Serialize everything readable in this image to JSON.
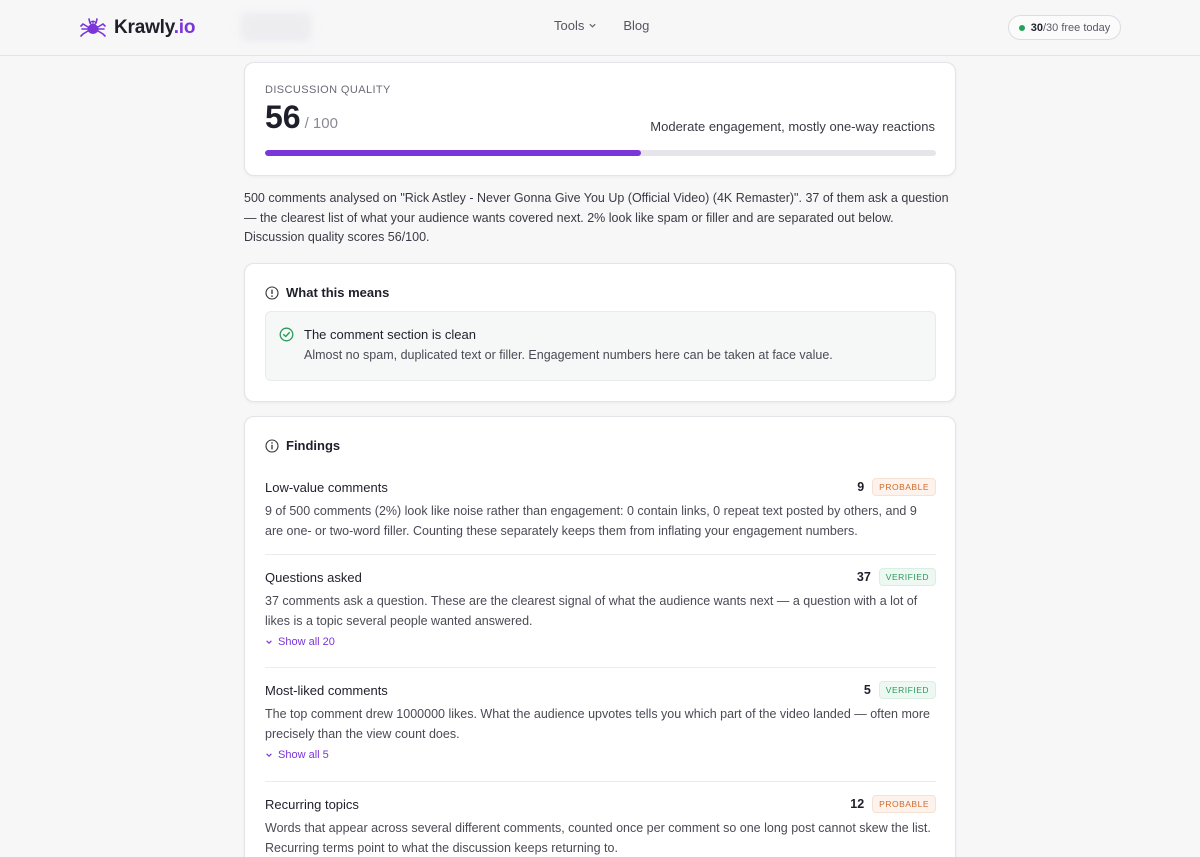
{
  "nav": {
    "brand_main": "Krawly",
    "brand_tld": ".io",
    "links": [
      {
        "label": "Tools",
        "has_dropdown": true
      },
      {
        "label": "Blog",
        "has_dropdown": false
      }
    ],
    "quota": {
      "used": "30",
      "rest": "/30 free today",
      "status_color": "#22a35a"
    }
  },
  "score": {
    "label": "DISCUSSION QUALITY",
    "value": "56",
    "max": "/ 100",
    "fraction": 0.56,
    "description": "Moderate engagement, mostly one-way reactions",
    "accent": "#7b36d9"
  },
  "summary": "500 comments analysed on \"Rick Astley - Never Gonna Give You Up (Official Video) (4K Remaster)\". 37 of them ask a question — the clearest list of what your audience wants covered next. 2% look like spam or filler and are separated out below. Discussion quality scores 56/100.",
  "meaning": {
    "title": "What this means",
    "icon": "info-circle-icon",
    "status_title": "The comment section is clean",
    "status_icon": "check-circle-icon",
    "status_text": "Almost no spam, duplicated text or filler. Engagement numbers here can be taken at face value."
  },
  "findings": {
    "title": "Findings",
    "icon": "info-circle-icon",
    "items": [
      {
        "title": "Low-value comments",
        "count": "9",
        "badge": "PROBABLE",
        "body": "9 of 500 comments (2%) look like noise rather than engagement: 0 contain links, 0 repeat text posted by others, and 9 are one- or two-word filler. Counting these separately keeps them from inflating your engagement numbers."
      },
      {
        "title": "Questions asked",
        "count": "37",
        "badge": "VERIFIED",
        "body": "37 comments ask a question. These are the clearest signal of what the audience wants next — a question with a lot of likes is a topic several people wanted answered.",
        "show_all": "Show all 20"
      },
      {
        "title": "Most-liked comments",
        "count": "5",
        "badge": "VERIFIED",
        "body": "The top comment drew 1000000 likes. What the audience upvotes tells you which part of the video landed — often more precisely than the view count does.",
        "show_all": "Show all 5"
      },
      {
        "title": "Recurring topics",
        "count": "12",
        "badge": "PROBABLE",
        "body": "Words that appear across several different comments, counted once per comment so one long post cannot skew the list. Recurring terms point to what the discussion keeps returning to."
      }
    ]
  }
}
